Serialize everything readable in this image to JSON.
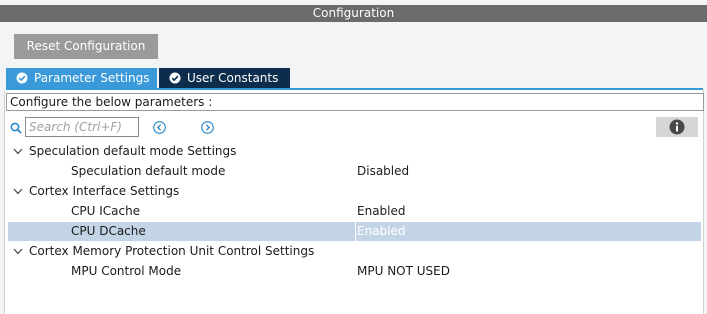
{
  "window": {
    "title": "Configuration"
  },
  "toolbar": {
    "reset_label": "Reset Configuration"
  },
  "tabs": [
    {
      "label": "Parameter Settings",
      "active": true,
      "icon": "check-circle-icon"
    },
    {
      "label": "User Constants",
      "active": false,
      "icon": "check-circle-icon"
    }
  ],
  "panel": {
    "configure_text": "Configure the below parameters :",
    "search": {
      "placeholder": "Search (Ctrl+F)",
      "value": ""
    }
  },
  "groups": [
    {
      "label": "Speculation default mode Settings",
      "expanded": true,
      "params": [
        {
          "label": "Speculation default mode",
          "value": "Disabled",
          "selected": false
        }
      ]
    },
    {
      "label": "Cortex Interface Settings",
      "expanded": true,
      "params": [
        {
          "label": "CPU ICache",
          "value": "Enabled",
          "selected": false
        },
        {
          "label": "CPU DCache",
          "value": "Enabled",
          "selected": true
        }
      ]
    },
    {
      "label": "Cortex Memory Protection Unit Control Settings",
      "expanded": true,
      "params": [
        {
          "label": "MPU Control Mode",
          "value": "MPU NOT USED",
          "selected": false
        }
      ]
    }
  ],
  "colors": {
    "titlebar": "#6b6b6b",
    "active_tab": "#3a9ad9",
    "inactive_tab": "#0d2d4d",
    "selected_row": "#c2d4e6",
    "accent_icon": "#3a9ad9"
  }
}
